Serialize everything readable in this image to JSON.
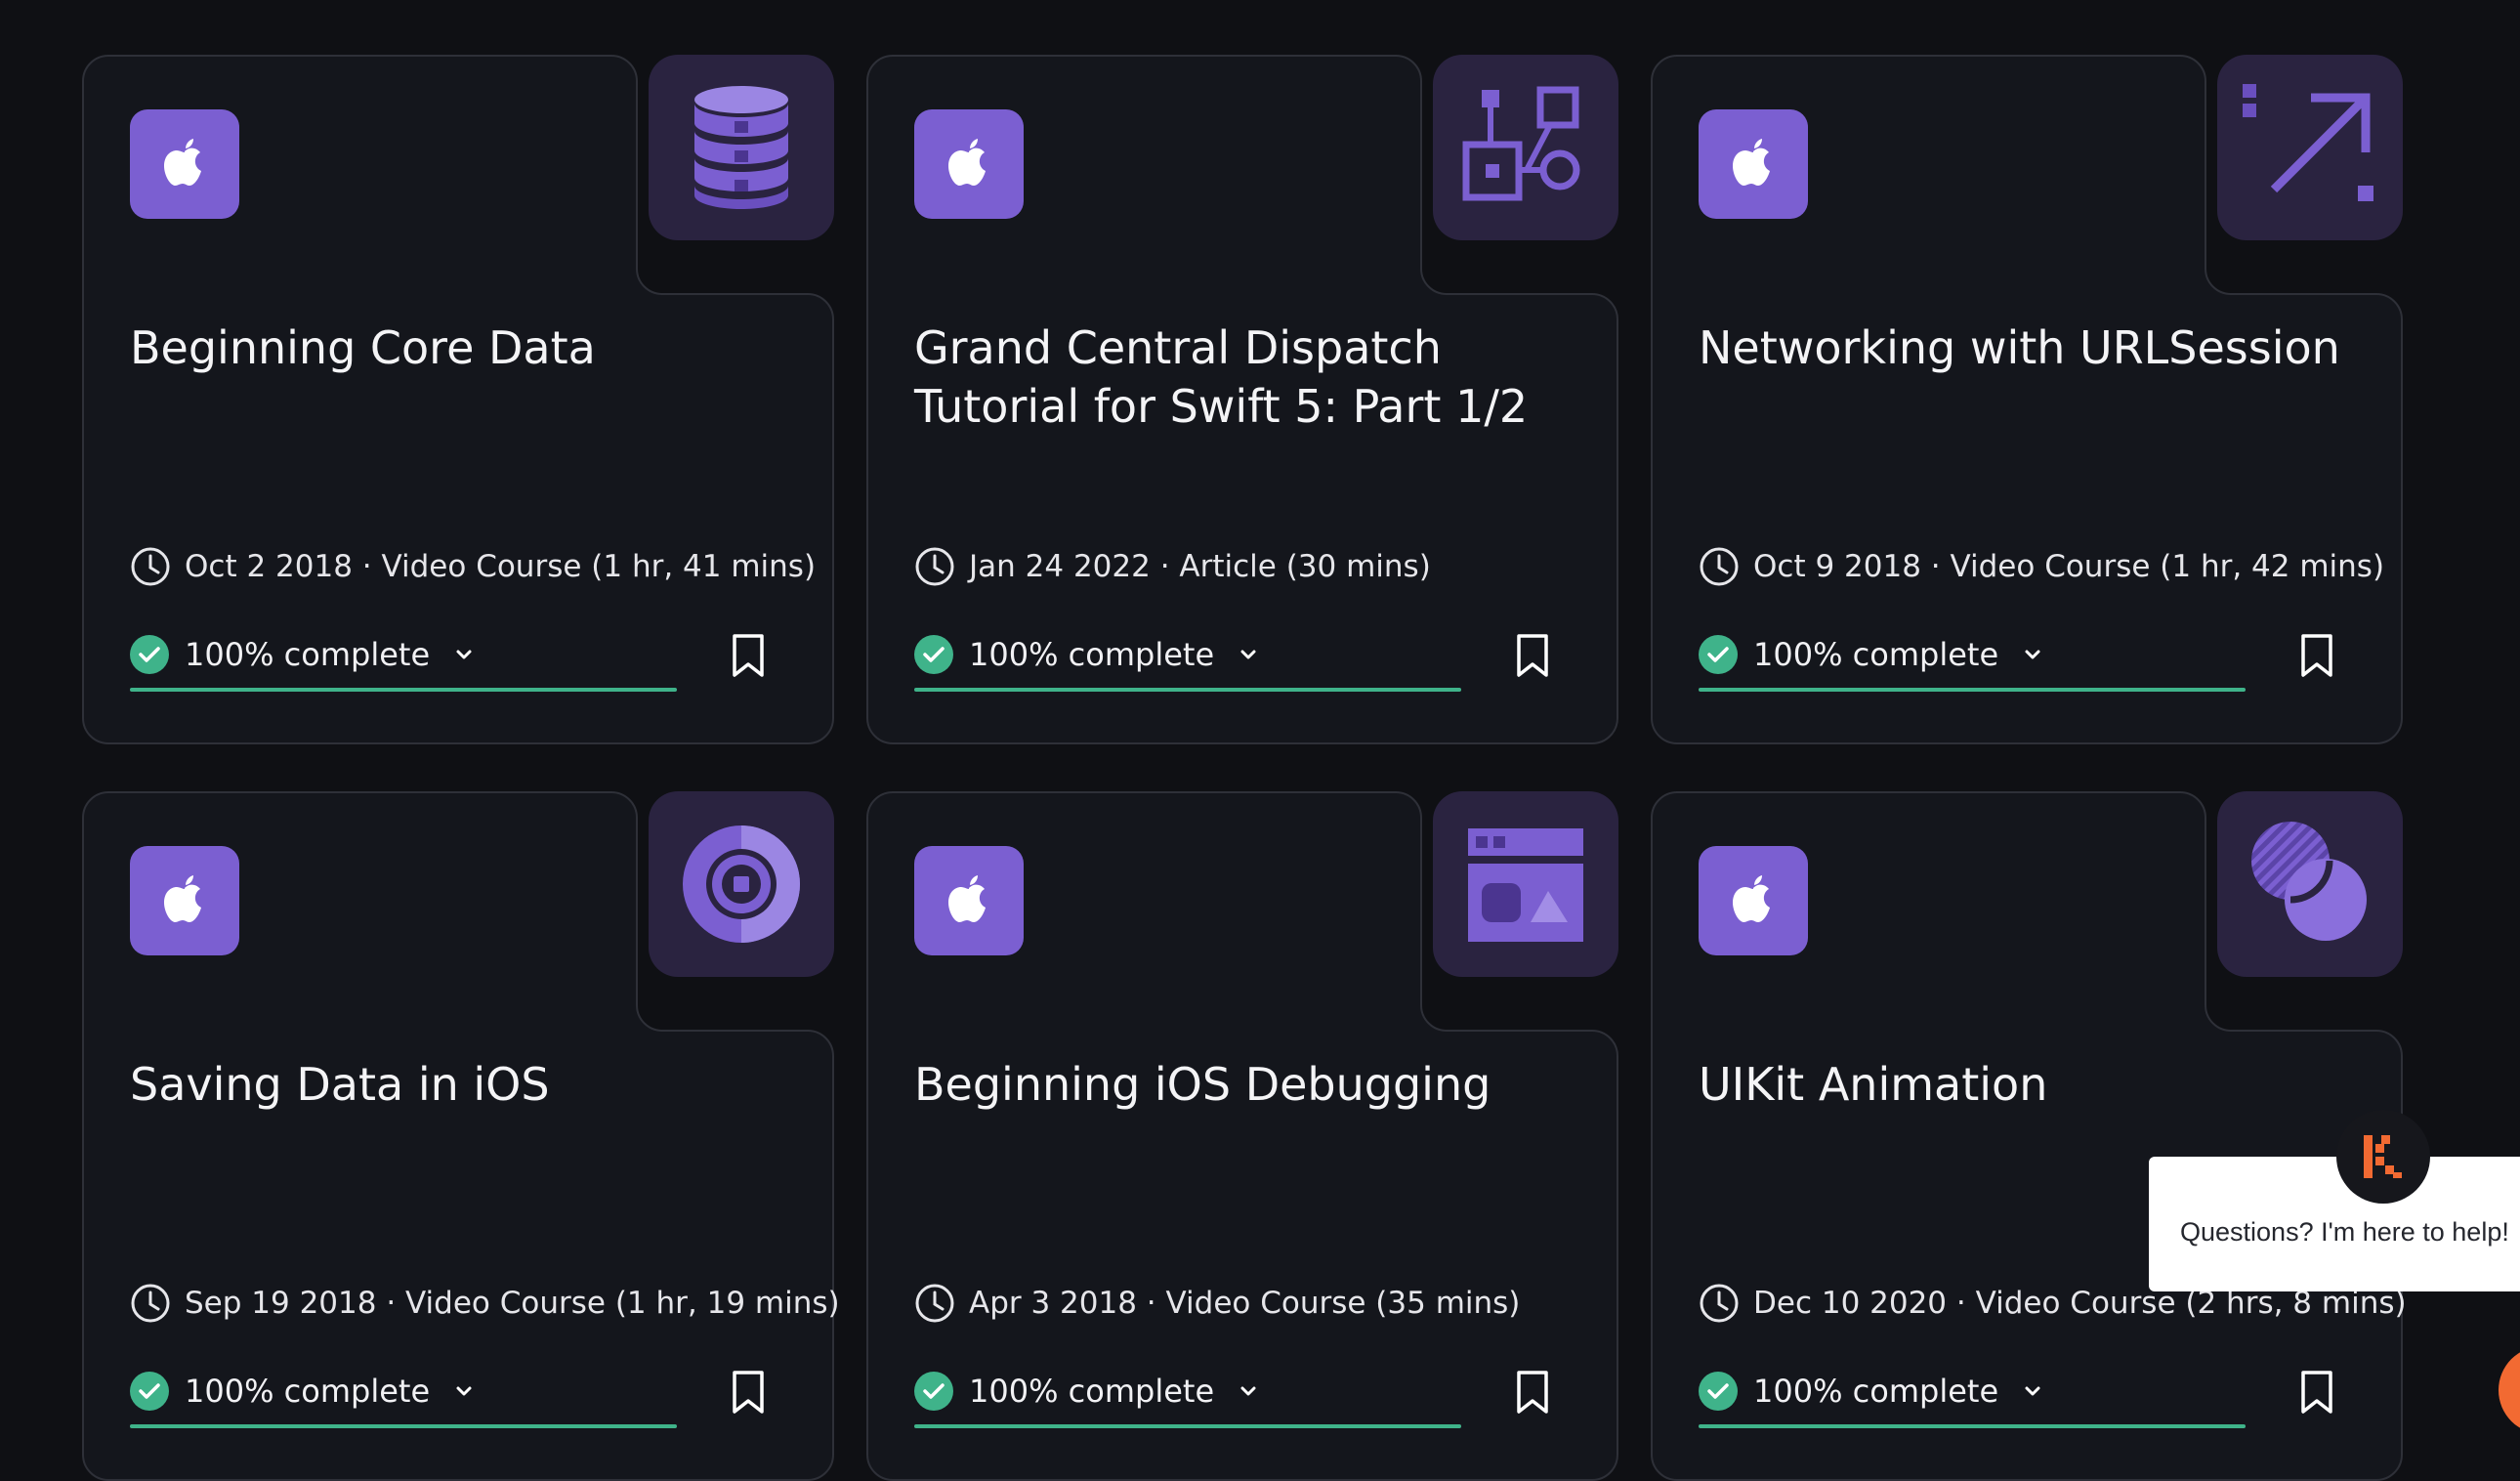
{
  "cards": [
    {
      "title": "Beginning Core Data",
      "meta": "Oct 2 2018 · Video Course (1 hr, 41 mins)",
      "progress_label": "100% complete",
      "progress": 1.0,
      "thumbnail_icon": "database-icon"
    },
    {
      "title": "Grand Central Dispatch Tutorial for Swift 5: Part 1/2",
      "meta": "Jan 24 2022 · Article (30 mins)",
      "progress_label": "100% complete",
      "progress": 1.0,
      "thumbnail_icon": "flow-nodes-icon"
    },
    {
      "title": "Networking with URLSession",
      "meta": "Oct 9 2018 · Video Course (1 hr, 42 mins)",
      "progress_label": "100% complete",
      "progress": 1.0,
      "thumbnail_icon": "network-arrow-icon"
    },
    {
      "title": "Saving Data in iOS",
      "meta": "Sep 19 2018 · Video Course (1 hr, 19 mins)",
      "progress_label": "100% complete",
      "progress": 1.0,
      "thumbnail_icon": "disk-icon"
    },
    {
      "title": "Beginning iOS Debugging",
      "meta": "Apr 3 2018 · Video Course (35 mins)",
      "progress_label": "100% complete",
      "progress": 1.0,
      "thumbnail_icon": "browser-window-icon"
    },
    {
      "title": "UIKit Animation",
      "meta": "Dec 10 2020 · Video Course (2 hrs, 8 mins)",
      "progress_label": "100% complete",
      "progress": 1.0,
      "thumbnail_icon": "overlapping-circles-icon"
    }
  ],
  "chat": {
    "message": "Questions? I'm here to help!",
    "logo_letter": "K"
  },
  "colors": {
    "background": "#0f1014",
    "card": "#14161c",
    "card_border": "#2e3038",
    "accent_purple": "#7b5fd1",
    "thumb_bg": "#2a2340",
    "progress_green": "#3fb38a",
    "chat_accent": "#f26a32"
  }
}
